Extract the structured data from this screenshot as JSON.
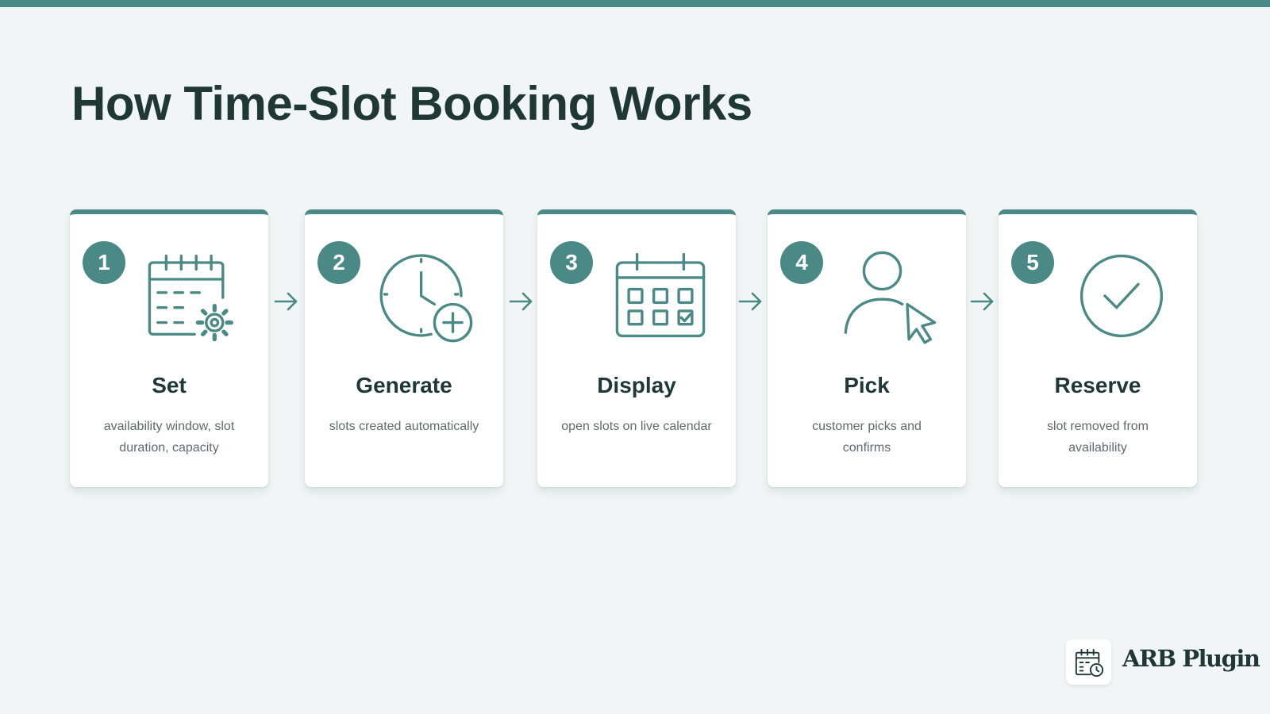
{
  "title": "How Time-Slot Booking Works",
  "colors": {
    "accent": "#4a8985",
    "title": "#1f3836",
    "body_text": "#5e6b6a",
    "background": "#f1f5f5"
  },
  "steps": [
    {
      "number": "1",
      "title": "Set",
      "description": "availability window, slot duration, capacity",
      "icon": "calendar-gear-icon"
    },
    {
      "number": "2",
      "title": "Generate",
      "description": "slots created automatically",
      "icon": "clock-plus-icon"
    },
    {
      "number": "3",
      "title": "Display",
      "description": "open slots on live calendar",
      "icon": "calendar-grid-icon"
    },
    {
      "number": "4",
      "title": "Pick",
      "description": "customer picks and confirms",
      "icon": "user-cursor-icon"
    },
    {
      "number": "5",
      "title": "Reserve",
      "description": "slot removed from availability",
      "icon": "check-circle-icon"
    }
  ],
  "brand": {
    "name": "ARB Plugin",
    "icon": "calendar-clock-icon"
  }
}
